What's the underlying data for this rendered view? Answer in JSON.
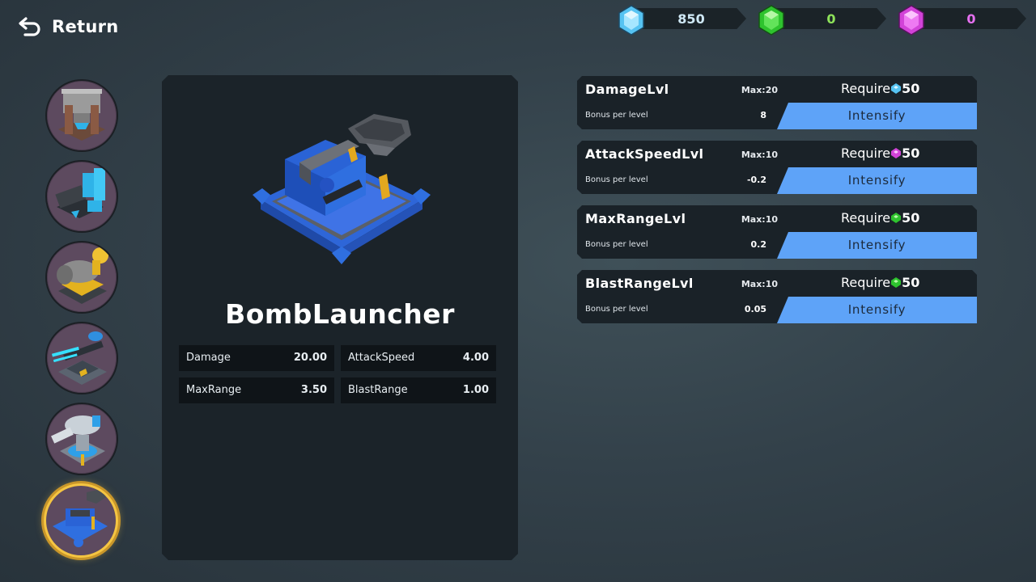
{
  "header": {
    "return_label": "Return"
  },
  "currencies": [
    {
      "name": "blue-gem",
      "amount": "850",
      "color": "#cfe8f5",
      "gem_color": "#56c3f2"
    },
    {
      "name": "green-gem",
      "amount": "0",
      "color": "#8ee35a",
      "gem_color": "#2ec32e"
    },
    {
      "name": "purple-gem",
      "amount": "0",
      "color": "#e670f0",
      "gem_color": "#d243d8"
    }
  ],
  "sidebar": {
    "towers": [
      {
        "icon": "crusher-tower-icon"
      },
      {
        "icon": "laser-cannon-tower-icon"
      },
      {
        "icon": "gold-cannon-tower-icon"
      },
      {
        "icon": "tesla-tower-icon"
      },
      {
        "icon": "frost-tower-icon"
      },
      {
        "icon": "bomb-launcher-tower-icon",
        "selected": true
      }
    ]
  },
  "detail": {
    "name": "BombLauncher",
    "stats": [
      {
        "label": "Damage",
        "value": "20.00"
      },
      {
        "label": "AttackSpeed",
        "value": "4.00"
      },
      {
        "label": "MaxRange",
        "value": "3.50"
      },
      {
        "label": "BlastRange",
        "value": "1.00"
      }
    ]
  },
  "upgrades": [
    {
      "name": "DamageLvl",
      "max": "Max:20",
      "require_label": "Require",
      "cost": "50",
      "gem": "blue-gem",
      "bonus_label": "Bonus per level",
      "bonus": "8",
      "button": "Intensify"
    },
    {
      "name": "AttackSpeedLvl",
      "max": "Max:10",
      "require_label": "Require",
      "cost": "50",
      "gem": "purple-gem",
      "bonus_label": "Bonus per level",
      "bonus": "-0.2",
      "button": "Intensify"
    },
    {
      "name": "MaxRangeLvl",
      "max": "Max:10",
      "require_label": "Require",
      "cost": "50",
      "gem": "green-gem",
      "bonus_label": "Bonus per level",
      "bonus": "0.2",
      "button": "Intensify"
    },
    {
      "name": "BlastRangeLvl",
      "max": "Max:10",
      "require_label": "Require",
      "cost": "50",
      "gem": "green-gem",
      "bonus_label": "Bonus per level",
      "bonus": "0.05",
      "button": "Intensify"
    }
  ]
}
